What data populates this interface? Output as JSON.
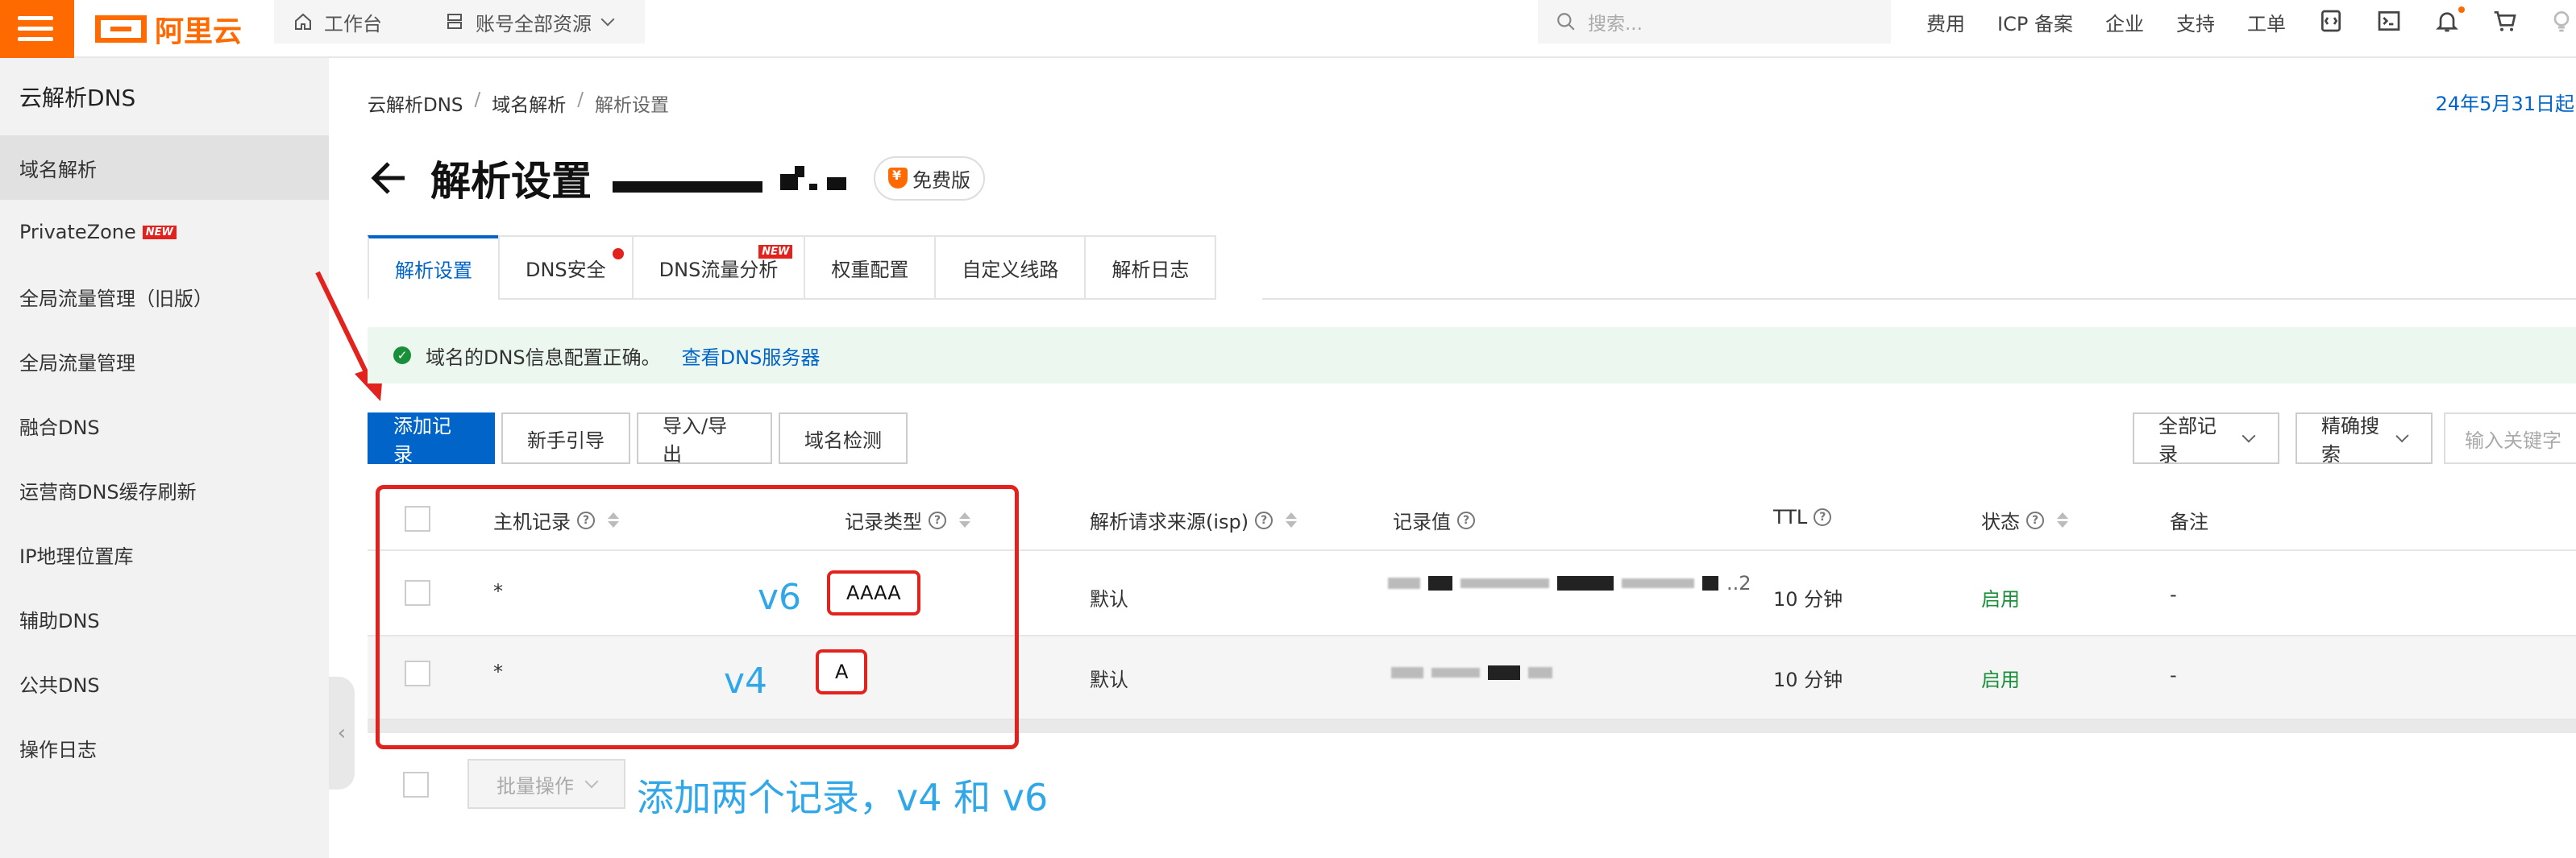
{
  "topbar": {
    "logo_text": "阿里云",
    "workbench": "工作台",
    "resource_scope": "账号全部资源",
    "search_placeholder": "搜索...",
    "nav": [
      "费用",
      "ICP 备案",
      "企业",
      "支持",
      "工单"
    ]
  },
  "sidebar": {
    "title": "云解析DNS",
    "items": [
      {
        "label": "域名解析"
      },
      {
        "label": "PrivateZone",
        "badge": "NEW"
      },
      {
        "label": "全局流量管理（旧版）"
      },
      {
        "label": "全局流量管理"
      },
      {
        "label": "融合DNS"
      },
      {
        "label": "运营商DNS缓存刷新"
      },
      {
        "label": "IP地理位置库"
      },
      {
        "label": "辅助DNS"
      },
      {
        "label": "公共DNS"
      },
      {
        "label": "操作日志"
      }
    ]
  },
  "breadcrumb": [
    "云解析DNS",
    "域名解析",
    "解析设置"
  ],
  "date_note": "24年5月31日起",
  "page": {
    "title": "解析设置",
    "edition": "免费版"
  },
  "tabs": [
    {
      "label": "解析设置"
    },
    {
      "label": "DNS安全"
    },
    {
      "label": "DNS流量分析",
      "badge": "NEW"
    },
    {
      "label": "权重配置"
    },
    {
      "label": "自定义线路"
    },
    {
      "label": "解析日志"
    }
  ],
  "notice": {
    "text": "域名的DNS信息配置正确。",
    "link": "查看DNS服务器"
  },
  "toolbar": {
    "add": "添加记录",
    "guide": "新手引导",
    "import_export": "导入/导出",
    "check": "域名检测",
    "filter": "全部记录",
    "search_mode": "精确搜索",
    "keyword_placeholder": "输入关键字"
  },
  "table": {
    "headers": {
      "host": "主机记录",
      "type": "记录类型",
      "isp": "解析请求来源(isp)",
      "value": "记录值",
      "ttl": "TTL",
      "status": "状态",
      "remark": "备注"
    },
    "rows": [
      {
        "host": "*",
        "type": "AAAA",
        "isp": "默认",
        "ttl": "10 分钟",
        "status": "启用",
        "remark": "-",
        "value_hint": "..2"
      },
      {
        "host": "*",
        "type": "A",
        "isp": "默认",
        "ttl": "10 分钟",
        "status": "启用",
        "remark": "-"
      }
    ]
  },
  "annotations": {
    "v6": "v6",
    "v4": "v4",
    "caption": "添加两个记录，v4 和 v6"
  },
  "batch": "批量操作",
  "colors": {
    "brand": "#ff6a00",
    "primary": "#0064c8",
    "annotation": "#2fa7e8",
    "highlight": "#e3211d",
    "enabled": "#1a8f3a"
  }
}
